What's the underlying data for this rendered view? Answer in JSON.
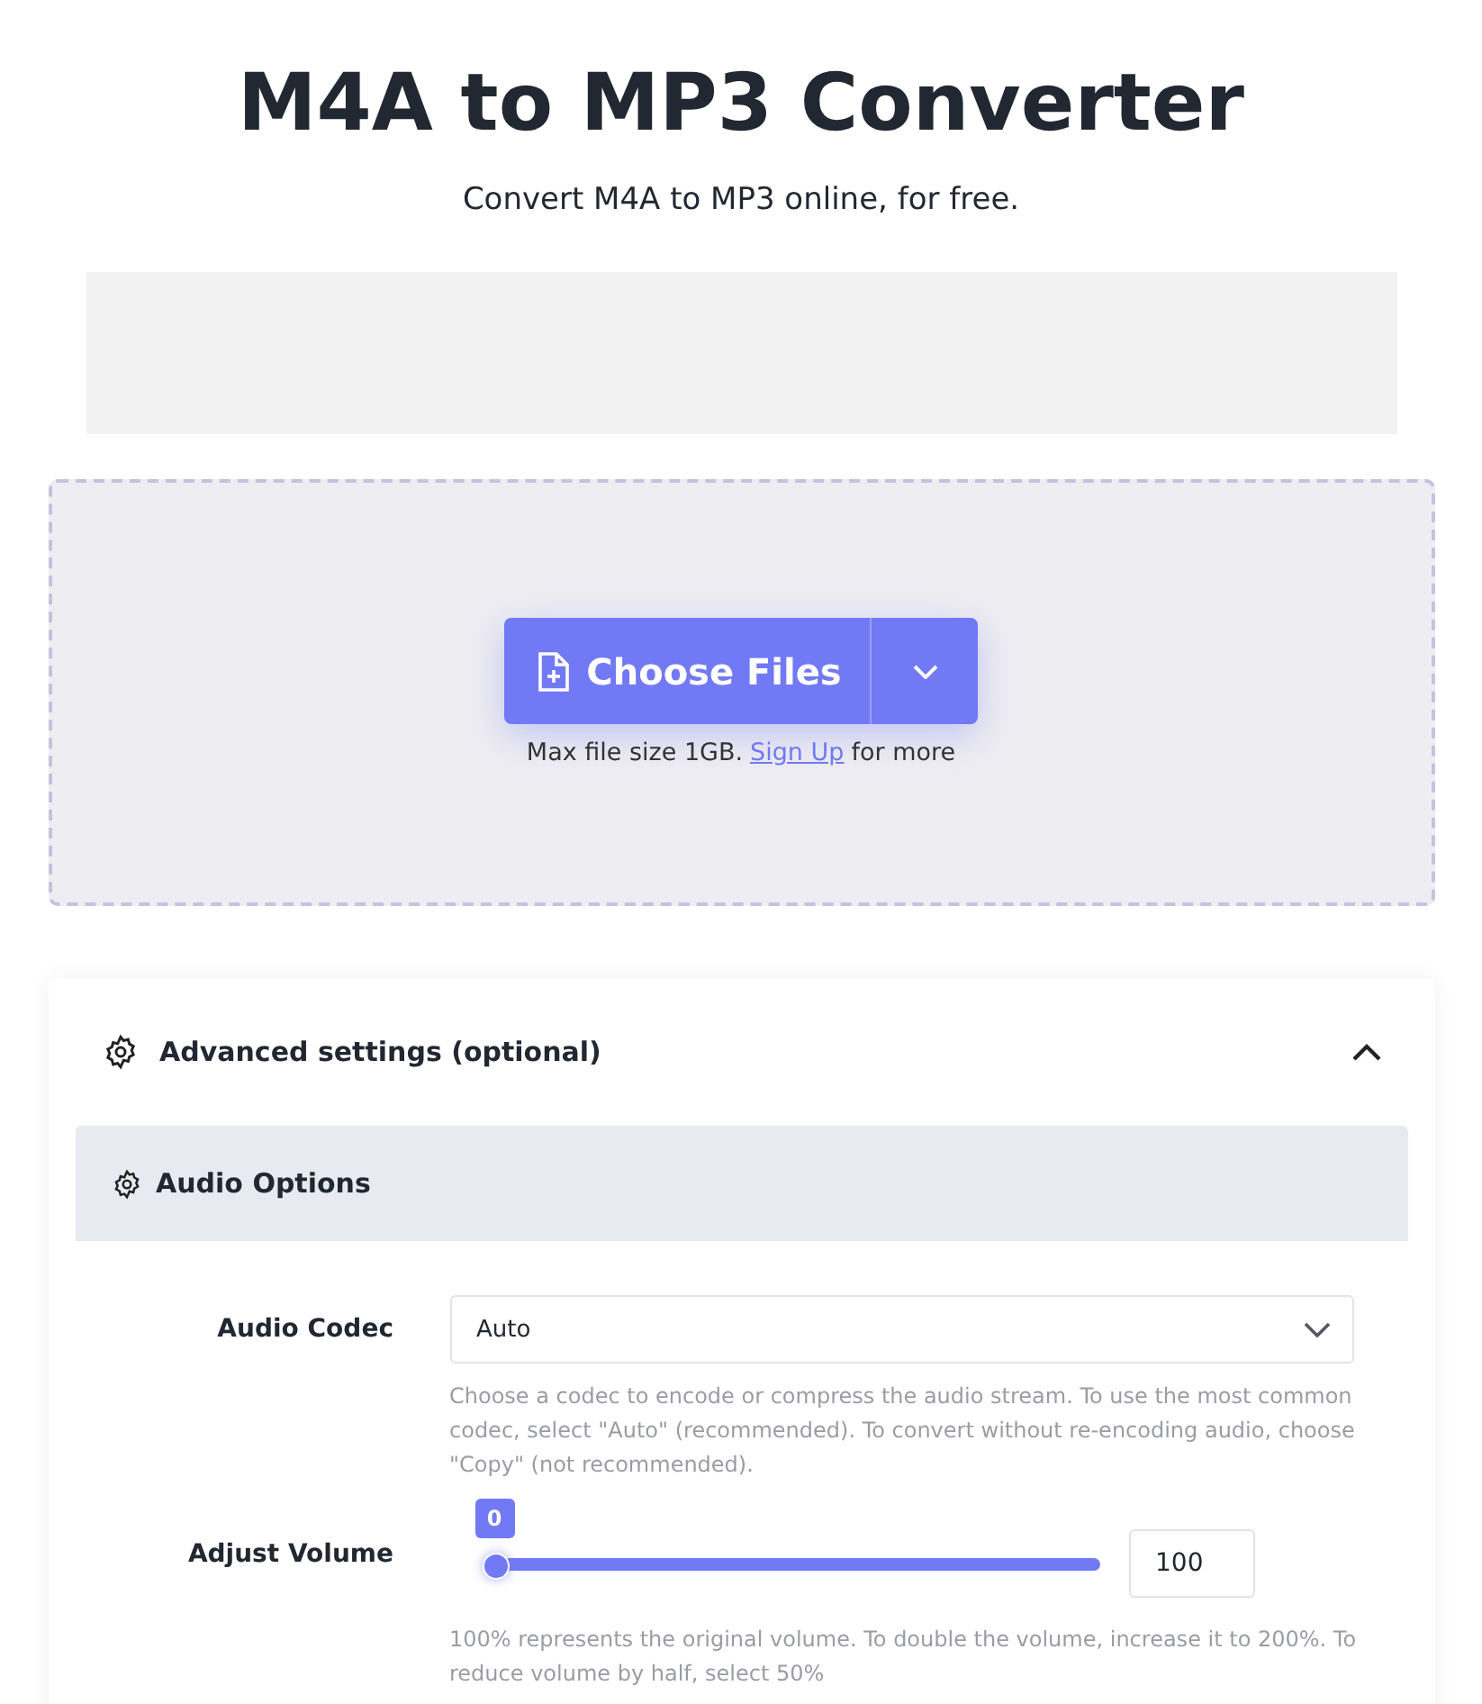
{
  "title": "M4A to MP3 Converter",
  "subtitle": "Convert M4A to MP3 online, for free.",
  "upload": {
    "button": "Choose Files",
    "note_before": "Max file size 1GB.",
    "link": "Sign Up",
    "note_after": "for more"
  },
  "advanced": {
    "title": "Advanced settings (optional)",
    "expanded": true,
    "section": {
      "title": "Audio Options"
    },
    "fields": [
      {
        "kind": "select",
        "label": "Audio Codec",
        "value": "Auto",
        "help": "Choose a codec to encode or compress the audio stream. To use the most common codec, select \"Auto\" (recommended). To convert without re-encoding audio, choose \"Copy\" (not recommended)."
      },
      {
        "kind": "slider",
        "label": "Adjust Volume",
        "bubble": "0",
        "level": 0,
        "value": "100",
        "help": "100% represents the original volume. To double the volume, increase it to 200%. To reduce volume by half, select 50%"
      }
    ]
  }
}
